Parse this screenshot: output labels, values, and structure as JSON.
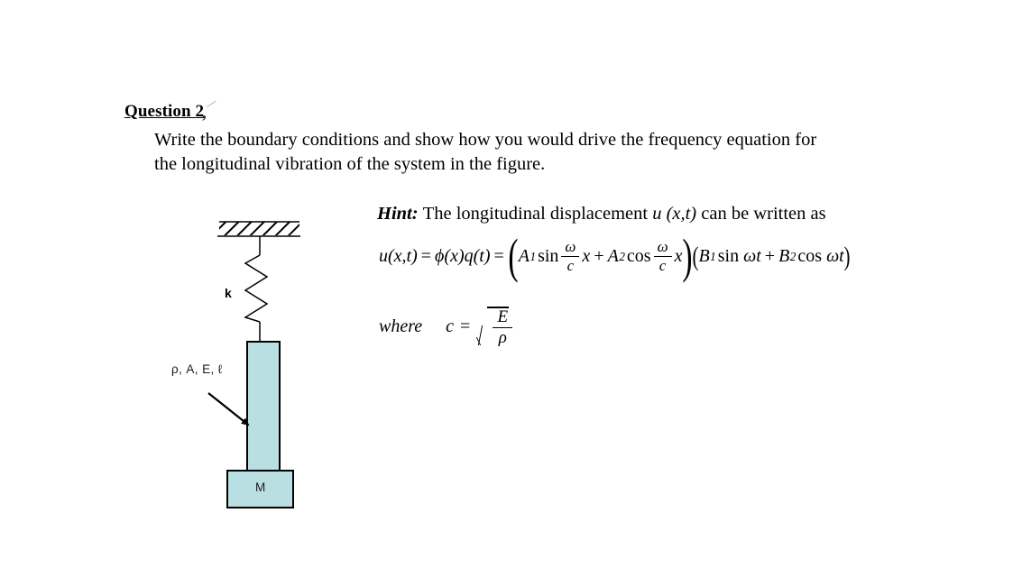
{
  "document": {
    "heading": {
      "text": "Question 2",
      "trailing_punctuation": ","
    },
    "body": {
      "line1": "Write the boundary conditions and show how you would drive the frequency equation for",
      "line2": "the longitudinal vibration of the system in the figure."
    },
    "hint": {
      "label": "Hint:",
      "text_before_var": "The longitudinal displacement",
      "variable": "u (x,t)",
      "text_after_var": "can be written as"
    },
    "equation": {
      "lhs_u": "u",
      "lhs_args": "(x,t)",
      "equals": "=",
      "phi": "ϕ",
      "phi_arg": "(x)",
      "q": "q",
      "q_arg": "(t)",
      "equals2": "=",
      "open_paren": "(",
      "A1": "A",
      "A1_sub": "1",
      "sin": "sin",
      "omega": "ω",
      "c": "c",
      "x": "x",
      "plus": "+",
      "A2": "A",
      "A2_sub": "2",
      "cos": "cos",
      "close_paren": ")",
      "open_paren2": "(",
      "B1": "B",
      "B1_sub": "1",
      "sin2": "sin",
      "omega_t": "ωt",
      "plus2": "+",
      "B2": "B",
      "B2_sub": "2",
      "cos2": "cos",
      "omega_t2": "ωt",
      "close_paren2": ")"
    },
    "where": {
      "word": "where",
      "c": "c",
      "equals": "=",
      "numerator": "E",
      "denominator": "ρ"
    }
  },
  "figure": {
    "spring_label": "k",
    "bar_properties_label": "ρ, A, E, ℓ",
    "mass_label": "M",
    "colors": {
      "bar_fill": "#b9dfe2",
      "mass_fill": "#b9dfe2",
      "outline": "#000000",
      "hatch": "#000000"
    }
  }
}
